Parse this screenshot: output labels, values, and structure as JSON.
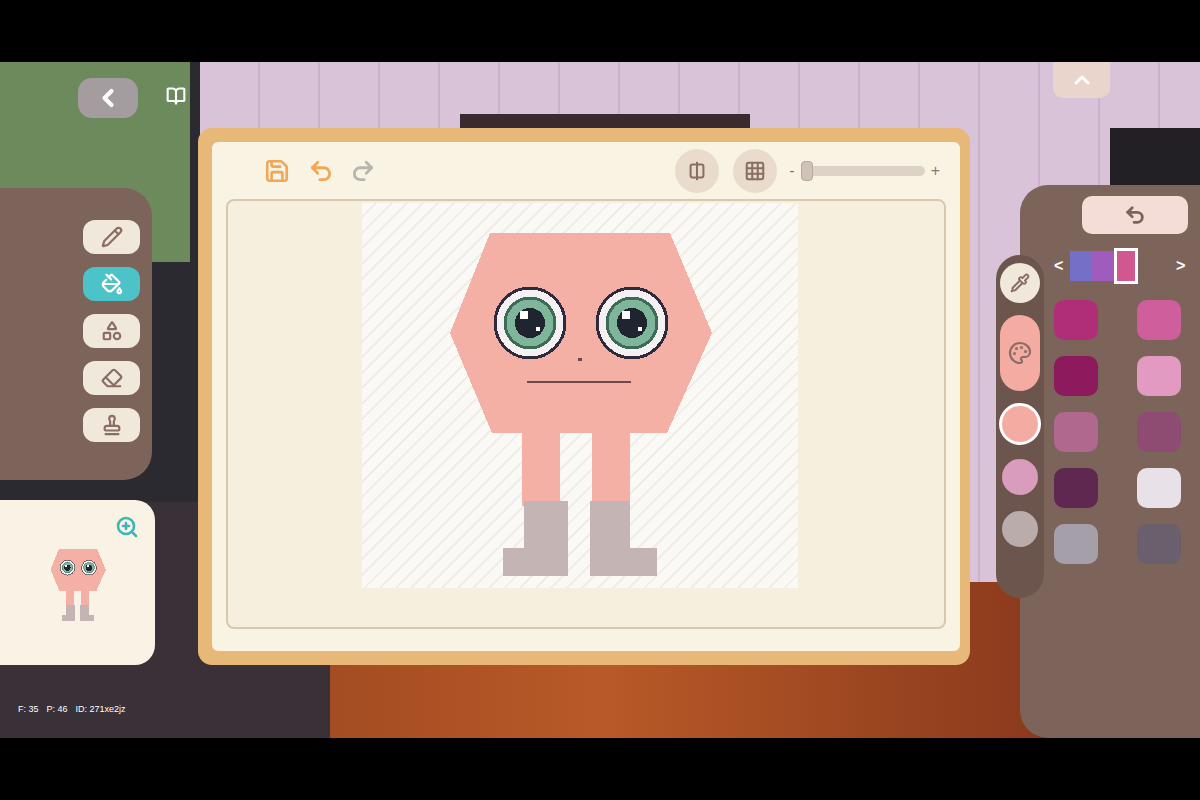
{
  "debug": {
    "fps": "F: 35",
    "ping": "P: 46",
    "id": "ID: 271xe2jz"
  },
  "toolbar": {
    "save_disabled": false,
    "undo_disabled": false,
    "redo_disabled": true,
    "mirror_on": false,
    "grid_on": false
  },
  "zoom": {
    "minus": "-",
    "plus": "+",
    "level": 0.02
  },
  "tools": [
    {
      "kind": "pencil",
      "selected": false
    },
    {
      "kind": "fill",
      "selected": true
    },
    {
      "kind": "shapes",
      "selected": false
    },
    {
      "kind": "eraser",
      "selected": false
    },
    {
      "kind": "stamp",
      "selected": false
    }
  ],
  "palette_nav": {
    "prev": "<",
    "next": ">"
  },
  "palette_pages": [
    {
      "color": "#7470c8",
      "selected": false
    },
    {
      "color": "#a05cbc",
      "selected": false
    },
    {
      "color": "#d0588e",
      "selected": true
    }
  ],
  "color_modes": [
    {
      "kind": "eyedropper",
      "selected": false
    },
    {
      "kind": "palette",
      "selected": true
    }
  ],
  "recent_colors": [
    {
      "color": "#f4aca2",
      "selected": true
    },
    {
      "color": "#d99cbc",
      "selected": false
    },
    {
      "color": "#bbacac",
      "selected": false
    }
  ],
  "swatches": [
    {
      "color": "#b02e78",
      "selected": false
    },
    {
      "color": "#cf5f9c",
      "selected": false
    },
    {
      "color": "#8c1a5c",
      "selected": false
    },
    {
      "color": "#e29ac2",
      "selected": false
    },
    {
      "color": "#b0688f",
      "selected": false
    },
    {
      "color": "#8e4c73",
      "selected": false
    },
    {
      "color": "#5e2850",
      "selected": false
    },
    {
      "color": "#e9e1e8",
      "selected": false
    },
    {
      "color": "#a59fa9",
      "selected": false
    },
    {
      "color": "#6a5f6c",
      "selected": false
    }
  ]
}
